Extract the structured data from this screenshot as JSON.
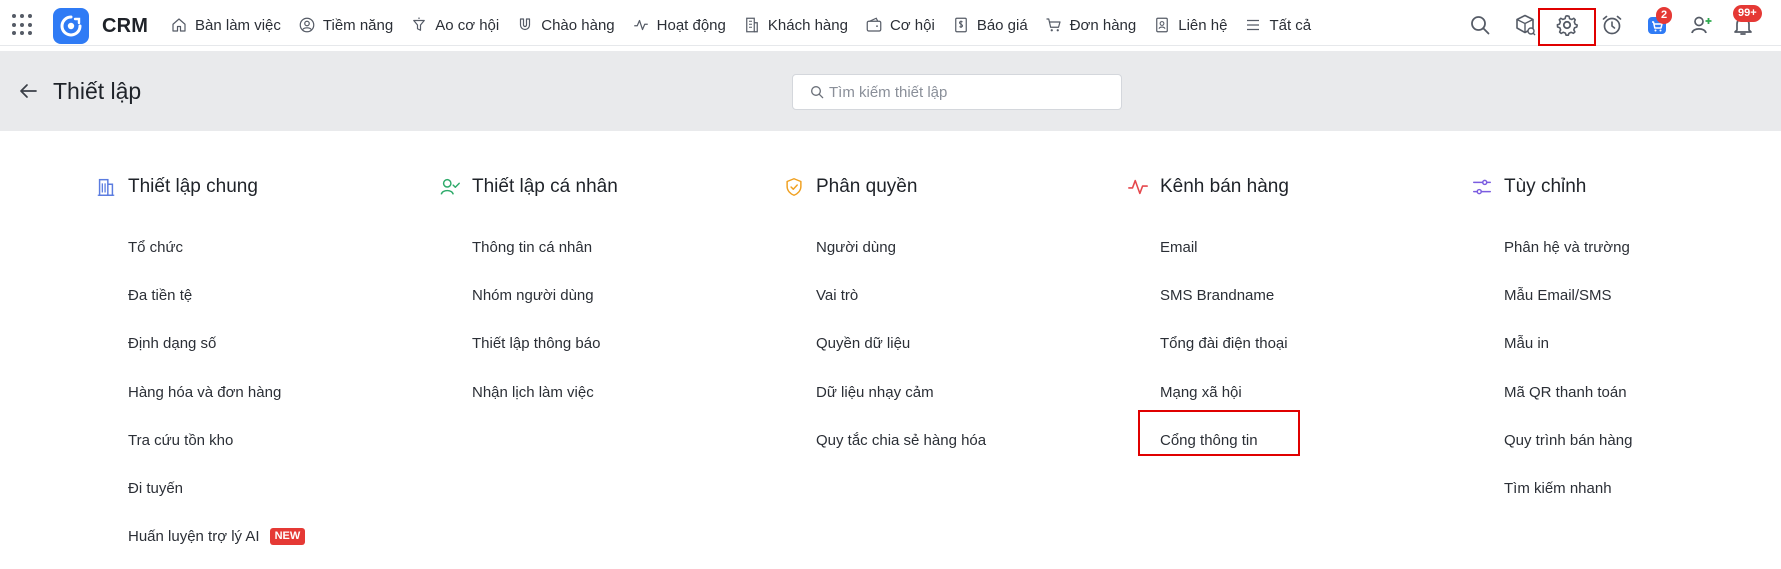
{
  "app": {
    "name": "CRM"
  },
  "nav": {
    "items": [
      {
        "label": "Bàn làm việc",
        "icon": "home-icon"
      },
      {
        "label": "Tiềm năng",
        "icon": "user-circle-icon"
      },
      {
        "label": "Ao cơ hội",
        "icon": "funnel-icon"
      },
      {
        "label": "Chào hàng",
        "icon": "magnet-icon"
      },
      {
        "label": "Hoạt động",
        "icon": "activity-icon"
      },
      {
        "label": "Khách hàng",
        "icon": "building-icon"
      },
      {
        "label": "Cơ hội",
        "icon": "wallet-icon"
      },
      {
        "label": "Báo giá",
        "icon": "dollar-doc-icon"
      },
      {
        "label": "Đơn hàng",
        "icon": "cart-icon"
      },
      {
        "label": "Liên hệ",
        "icon": "contact-icon"
      },
      {
        "label": "Tất cả",
        "icon": "menu-lines-icon"
      }
    ]
  },
  "toolbar": {
    "cart_badge": "2",
    "notification_badge": "99+"
  },
  "page": {
    "title": "Thiết lập",
    "search_placeholder": "Tìm kiếm thiết lập"
  },
  "sections": {
    "general": {
      "title": "Thiết lập chung",
      "icon": "building-columns-icon",
      "items": [
        "Tổ chức",
        "Đa tiền tệ",
        "Định dạng số",
        "Hàng hóa và đơn hàng",
        "Tra cứu tồn kho",
        "Đi tuyến",
        "Huấn luyện trợ lý AI"
      ],
      "new_tag": "NEW"
    },
    "personal": {
      "title": "Thiết lập cá nhân",
      "icon": "user-check-icon",
      "items": [
        "Thông tin cá nhân",
        "Nhóm người dùng",
        "Thiết lập thông báo",
        "Nhận lịch làm việc"
      ]
    },
    "permission": {
      "title": "Phân quyền",
      "icon": "shield-check-icon",
      "items": [
        "Người dùng",
        "Vai trò",
        "Quyền dữ liệu",
        "Dữ liệu nhạy cảm",
        "Quy tắc chia sẻ hàng hóa"
      ]
    },
    "channels": {
      "title": "Kênh bán hàng",
      "icon": "pulse-icon",
      "items": [
        "Email",
        "SMS Brandname",
        "Tổng đài điện thoại",
        "Mạng xã hội",
        "Cổng thông tin"
      ]
    },
    "custom": {
      "title": "Tùy chỉnh",
      "icon": "sliders-icon",
      "items": [
        "Phân hệ và trường",
        "Mẫu Email/SMS",
        "Mẫu in",
        "Mã QR thanh toán",
        "Quy trình bán hàng",
        "Tìm kiếm nhanh"
      ]
    }
  },
  "colors": {
    "brand": "#2f7bf5",
    "highlight": "#e00000",
    "badge": "#e53935",
    "header_band": "#e9eaec"
  }
}
